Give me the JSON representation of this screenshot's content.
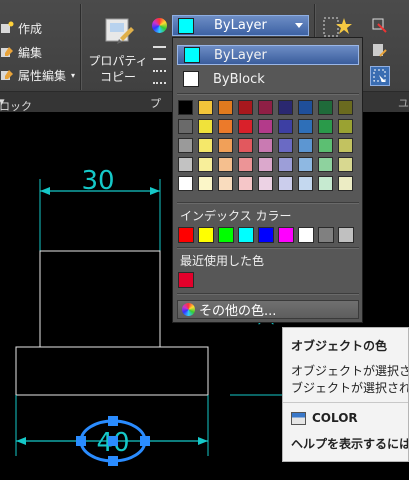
{
  "ribbon": {
    "block_items": [
      "作成",
      "編集",
      "属性編集"
    ],
    "block_group_label": "ロック",
    "properties_group_label": "プ",
    "match_properties_label": "プロパティ\nコピー",
    "right_group_label": "プ"
  },
  "color_combo": {
    "value": "ByLayer",
    "swatch_color": "#00ffff"
  },
  "dropdown": {
    "options": [
      {
        "label": "ByLayer",
        "color": "#00ffff",
        "selected": true
      },
      {
        "label": "ByBlock",
        "color": "#ffffff",
        "selected": false
      }
    ],
    "palette_rows": [
      [
        "#000000",
        "#f2c43a",
        "#e07a1e",
        "#a8181d",
        "#8f1f45",
        "#2a2870",
        "#1f4f9a",
        "#1f6a3a",
        "#6a6a1f"
      ],
      [
        "#6a6a6a",
        "#f0e23a",
        "#ec7a2a",
        "#d9202a",
        "#b33a8a",
        "#3d3fa3",
        "#2e6fb8",
        "#2a9a4a",
        "#9aa232"
      ],
      [
        "#9a9a9a",
        "#f5e86a",
        "#f1a058",
        "#e2585e",
        "#c97ab2",
        "#6a6ac4",
        "#5c96d2",
        "#5cbf72",
        "#c2c260"
      ],
      [
        "#c2c2c2",
        "#f8ef9a",
        "#f5bf8e",
        "#ec9496",
        "#dba8cc",
        "#9c9ed8",
        "#8eb8e2",
        "#8ed29e",
        "#d8d890"
      ],
      [
        "#ffffff",
        "#fbf6c8",
        "#f9dcbe",
        "#f5c6c8",
        "#ecd2e4",
        "#cbcdec",
        "#c4d8ef",
        "#c6ead0",
        "#ececc4"
      ]
    ],
    "index_color_label": "インデックス カラー",
    "index_colors": [
      "#ff0000",
      "#ffff00",
      "#00ff00",
      "#00ffff",
      "#0000ff",
      "#ff00ff",
      "#ffffff",
      "#808080",
      "#c0c0c0"
    ],
    "recent_label": "最近使用した色",
    "recent_colors": [
      "#e4002b"
    ],
    "other_colors_label": "その他の色..."
  },
  "tooltip": {
    "title": "オブジェクトの色",
    "line1": "オブジェクトが選択さ",
    "line2": "ブジェクトが選択され",
    "command": "COLOR",
    "help": "ヘルプを表示するには"
  },
  "drawing": {
    "dim_top": "30",
    "dim_bottom": "40"
  }
}
